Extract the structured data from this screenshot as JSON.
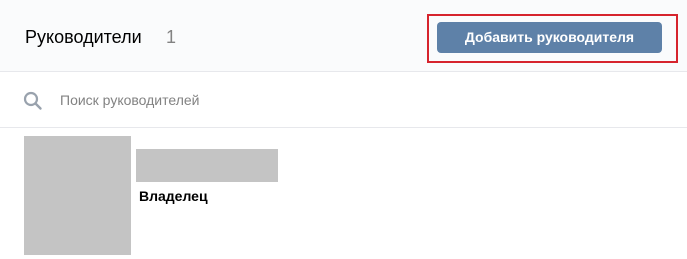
{
  "header": {
    "title": "Руководители",
    "count": "1",
    "add_button_label": "Добавить руководителя"
  },
  "search": {
    "placeholder": "Поиск руководителей",
    "value": ""
  },
  "managers": [
    {
      "role": "Владелец"
    }
  ],
  "colors": {
    "accent_button": "#5e81a8",
    "highlight_frame": "#d6242d",
    "placeholder_block": "#c4c4c4"
  }
}
